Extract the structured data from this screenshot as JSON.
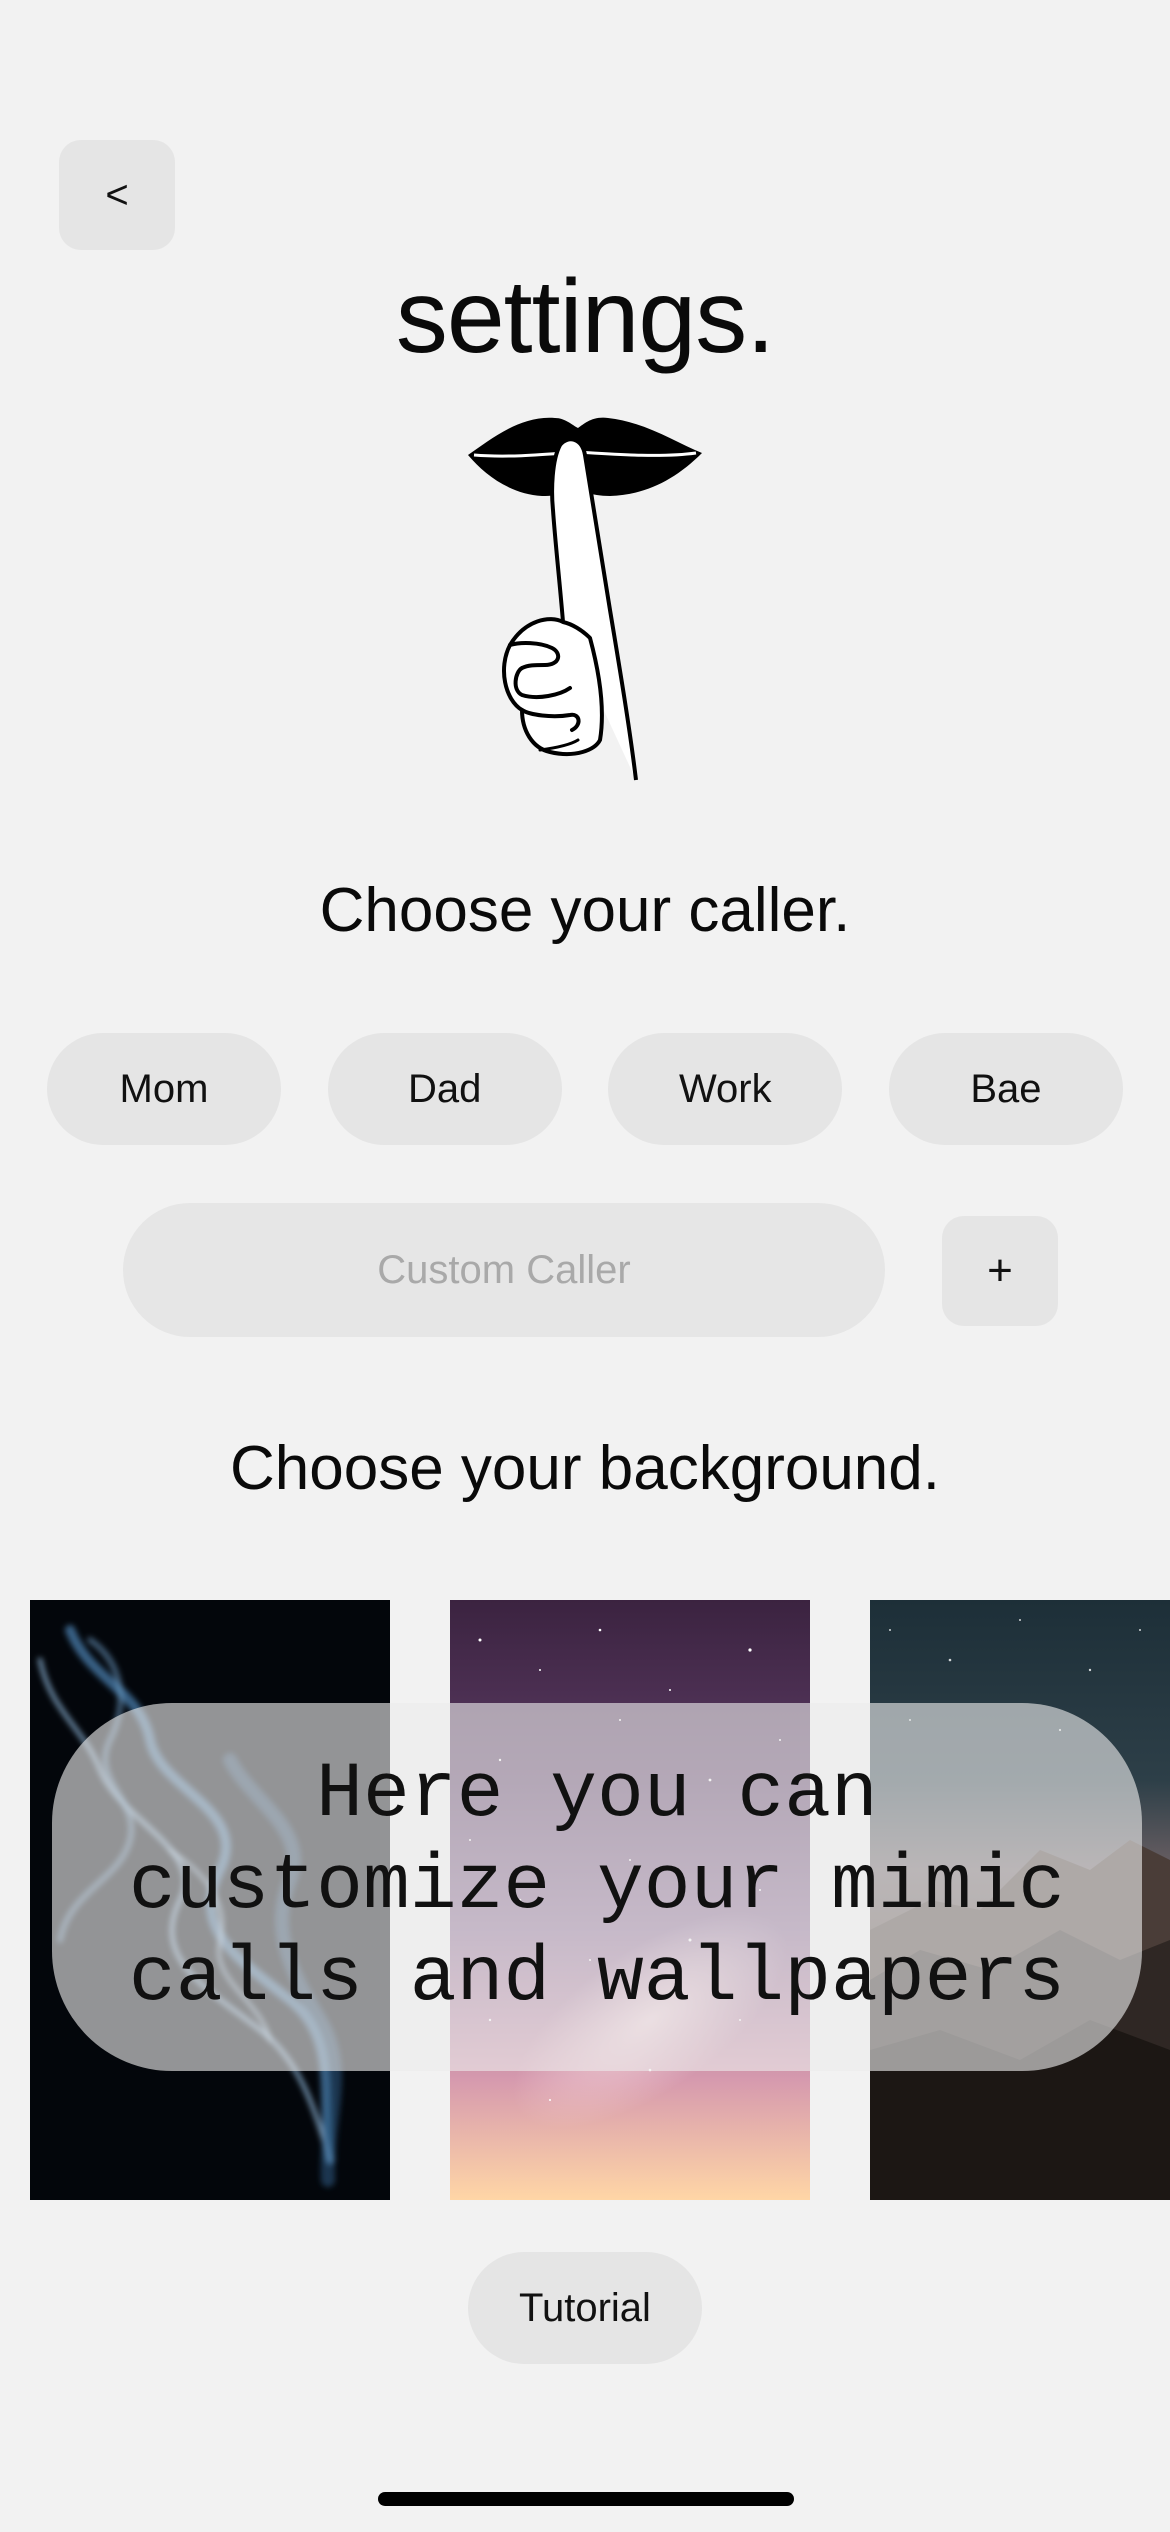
{
  "header": {
    "back_label": "<",
    "title": "settings."
  },
  "logo": {
    "icon": "shush-lips-finger-icon"
  },
  "caller_section": {
    "heading": "Choose your caller.",
    "options": [
      "Mom",
      "Dad",
      "Work",
      "Bae"
    ],
    "custom_placeholder": "Custom Caller",
    "custom_value": "",
    "add_label": "+"
  },
  "background_section": {
    "heading": "Choose your background.",
    "wallpapers": [
      "smoke",
      "galaxy",
      "mountain"
    ]
  },
  "tooltip": {
    "text": "Here you can\ncustomize your mimic\ncalls and wallpapers"
  },
  "footer": {
    "tutorial_label": "Tutorial"
  },
  "colors": {
    "background": "#f2f2f2",
    "chip": "#e5e5e5",
    "text": "#0a0a0a",
    "placeholder": "#a9a9a9"
  }
}
